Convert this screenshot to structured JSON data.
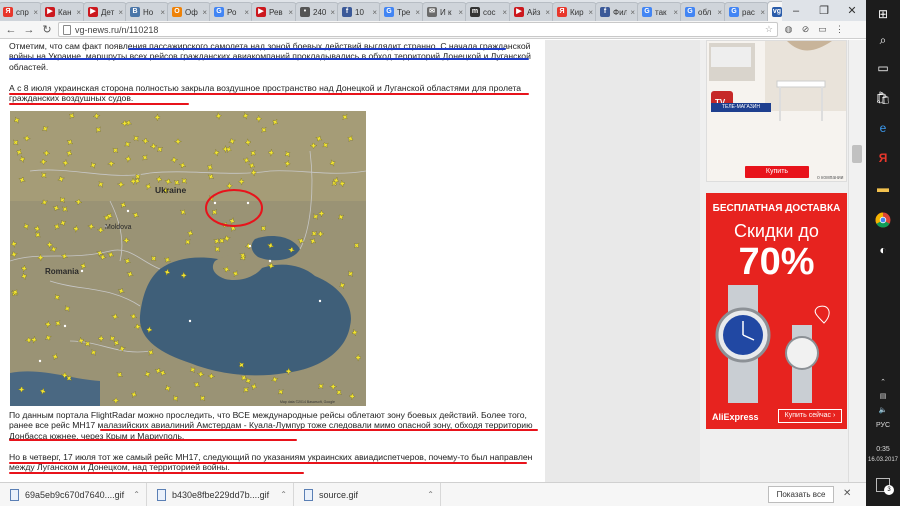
{
  "browser": {
    "tabs": [
      {
        "label": "спр",
        "color": "#e8372c",
        "glyph": "Я"
      },
      {
        "label": "Кан",
        "color": "#cc181e",
        "glyph": "▶"
      },
      {
        "label": "Дет",
        "color": "#cc181e",
        "glyph": "▶"
      },
      {
        "label": "Но",
        "color": "#4a76a8",
        "glyph": "В"
      },
      {
        "label": "Оф",
        "color": "#ee8208",
        "glyph": "О"
      },
      {
        "label": "Ро",
        "color": "#4285f4",
        "glyph": "G"
      },
      {
        "label": "Рев",
        "color": "#cc181e",
        "glyph": "▶"
      },
      {
        "label": "240",
        "color": "#555555",
        "glyph": "•"
      },
      {
        "label": "10",
        "color": "#3b5998",
        "glyph": "f"
      },
      {
        "label": "Тре",
        "color": "#4285f4",
        "glyph": "G"
      },
      {
        "label": "И к",
        "color": "#6a6a6a",
        "glyph": "✉"
      },
      {
        "label": "сос",
        "color": "#333333",
        "glyph": "m"
      },
      {
        "label": "Айз",
        "color": "#cc181e",
        "glyph": "▶"
      },
      {
        "label": "Кир",
        "color": "#e8372c",
        "glyph": "Я"
      },
      {
        "label": "Фил",
        "color": "#3b5998",
        "glyph": "f"
      },
      {
        "label": "так",
        "color": "#4285f4",
        "glyph": "G"
      },
      {
        "label": "обл",
        "color": "#4285f4",
        "glyph": "G"
      },
      {
        "label": "рас",
        "color": "#4285f4",
        "glyph": "G"
      },
      {
        "label": "",
        "color": "#2a5caa",
        "glyph": "vg",
        "active": true
      }
    ],
    "url": "vg-news.ru/n/110218"
  },
  "article": {
    "para1": "Отметим, что сам факт появления пассажирского самолета над зоной боевых действий выглядит странно. С начала гражданской войны на Украине, маршруты всех рейсов гражданских авиакомпаний прокладывались в обход территорий Донецкой и Луганской областей.",
    "para2": "А с 8 июля украинская сторона полностью закрыла воздушное пространство над Донецкой и Луганской областями для пролета гражданских воздушных судов.",
    "para3": "По данным портала FlightRadar можно проследить, что ВСЕ международные рейсы облетают зону боевых действий. Более того, ранее все рейс МН17 малазийских авиалиний Амстердам - Куала-Лумпур тоже следовали мимо опасной зону, обходя территорию Донбасса южнее, через Крым и Мариуполь.",
    "para4": "Но в четверг, 17 июля тот же самый рейс МН17, следующий по указаниям украинских авиадиспетчеров, почему-то был направлен между Луганском и Донецком, над территорией войны."
  },
  "map": {
    "country_ukraine": "Ukraine",
    "country_romania": "Romania",
    "city_moldova": "Moldova",
    "attribution": "Map data ©2014 Basarsoft, Google"
  },
  "ads": {
    "ad1_brand": "ТЕЛЕ-МАГАЗИН",
    "ad1_button": "Купить",
    "ad1_tag": "о компании",
    "ad2_headline": "БЕСПЛАТНАЯ ДОСТАВКА",
    "ad2_sub": "Скидки до",
    "ad2_percent": "70%",
    "ad2_brand": "AliExpress",
    "ad2_cta": "Купить сейчас ›"
  },
  "downloads": {
    "items": [
      "69a5eb9c670d7640....gif",
      "b430e8fbe229dd7b....gif",
      "source.gif"
    ],
    "show_all": "Показать все"
  },
  "taskbar": {
    "lang": "РУС",
    "time": "0:35",
    "date": "16.03.2017",
    "notifications": "3"
  },
  "colors": {
    "underline_red": "#e8131b",
    "underline_blue": "#1f3cc9",
    "ad_red": "#e7231f"
  }
}
